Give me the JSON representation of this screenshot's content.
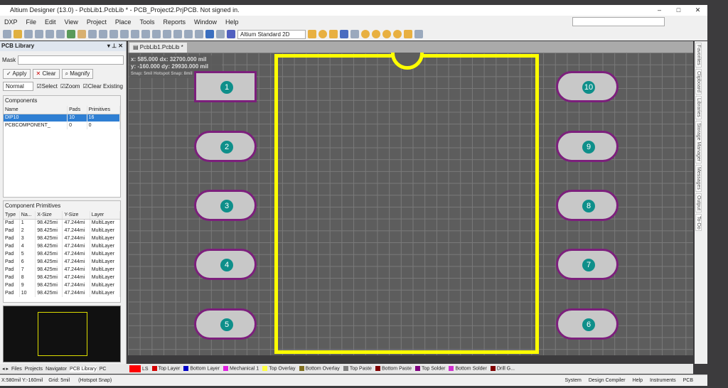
{
  "window": {
    "title": "Altium Designer (13.0) - PcbLib1.PcbLib * - PCB_Project2.PrjPCB. Not signed in.",
    "controls": [
      "–",
      "□",
      "✕"
    ]
  },
  "menu": [
    "DXP",
    "File",
    "Edit",
    "View",
    "Project",
    "Place",
    "Tools",
    "Reports",
    "Window",
    "Help"
  ],
  "toolbar": {
    "view_mode": "Altium Standard 2D"
  },
  "panel": {
    "title": "PCB Library",
    "mask_label": "Mask",
    "mask_value": "",
    "apply": "Apply",
    "clear": "Clear",
    "magnify": "Magnify",
    "mode": "Normal",
    "select": "Select",
    "zoom": "Zoom",
    "clear_existing": "Clear Existing",
    "components_title": "Components",
    "components_headers": [
      "Name",
      "Pads",
      "Primitives"
    ],
    "components": [
      [
        "DIP10",
        "10",
        "16"
      ],
      [
        "PCBCOMPONENT_",
        "0",
        "0"
      ]
    ],
    "primitives_title": "Component Primitives",
    "primitives_headers": [
      "Type",
      "Na...",
      "X-Size",
      "Y-Size",
      "Layer"
    ],
    "primitives": [
      [
        "Pad",
        "1",
        "98.425mi",
        "47.244mi",
        "MultiLayer"
      ],
      [
        "Pad",
        "2",
        "98.425mi",
        "47.244mi",
        "MultiLayer"
      ],
      [
        "Pad",
        "3",
        "98.425mi",
        "47.244mi",
        "MultiLayer"
      ],
      [
        "Pad",
        "4",
        "98.425mi",
        "47.244mi",
        "MultiLayer"
      ],
      [
        "Pad",
        "5",
        "98.425mi",
        "47.244mi",
        "MultiLayer"
      ],
      [
        "Pad",
        "6",
        "98.425mi",
        "47.244mi",
        "MultiLayer"
      ],
      [
        "Pad",
        "7",
        "98.425mi",
        "47.244mi",
        "MultiLayer"
      ],
      [
        "Pad",
        "8",
        "98.425mi",
        "47.244mi",
        "MultiLayer"
      ],
      [
        "Pad",
        "9",
        "98.425mi",
        "47.244mi",
        "MultiLayer"
      ],
      [
        "Pad",
        "10",
        "98.425mi",
        "47.244mi",
        "MultiLayer"
      ]
    ]
  },
  "panel_tabs": [
    "Files",
    "Projects",
    "Navigator",
    "PCB Library",
    "PC"
  ],
  "doc_tab": "PcbLib1.PcbLib *",
  "readout": {
    "line1": "x:  585.000   dx: 32700.000 mil",
    "line2": "y:  -160.000   dy: 29930.000 mil",
    "line3": "Snap: 5mil Hotspot Snap: 8mil"
  },
  "pads": {
    "left": [
      "1",
      "2",
      "3",
      "4",
      "5"
    ],
    "right": [
      "10",
      "9",
      "8",
      "7",
      "6"
    ]
  },
  "layers": [
    {
      "name": "LS",
      "color": "#ff0000"
    },
    {
      "name": "Top Layer",
      "color": "#d40000"
    },
    {
      "name": "Bottom Layer",
      "color": "#0000c8"
    },
    {
      "name": "Mechanical 1",
      "color": "#e020e0"
    },
    {
      "name": "Top Overlay",
      "color": "#ffff40"
    },
    {
      "name": "Bottom Overlay",
      "color": "#807020"
    },
    {
      "name": "Top Paste",
      "color": "#808080"
    },
    {
      "name": "Bottom Paste",
      "color": "#800000"
    },
    {
      "name": "Top Solder",
      "color": "#800080"
    },
    {
      "name": "Bottom Solder",
      "color": "#d030d0"
    },
    {
      "name": "Drill G...",
      "color": "#800000"
    }
  ],
  "status": {
    "coords": "X:580mil Y:-160mil",
    "grid": "Grid: 5mil",
    "snap": "(Hotspot Snap)",
    "buttons": [
      "System",
      "Design Compiler",
      "Help",
      "Instruments",
      "PCB"
    ]
  },
  "right_tabs": [
    "Favorites",
    "Clipboard",
    "Libraries",
    "Storage Manager",
    "Messages",
    "Output",
    "To-Do"
  ]
}
